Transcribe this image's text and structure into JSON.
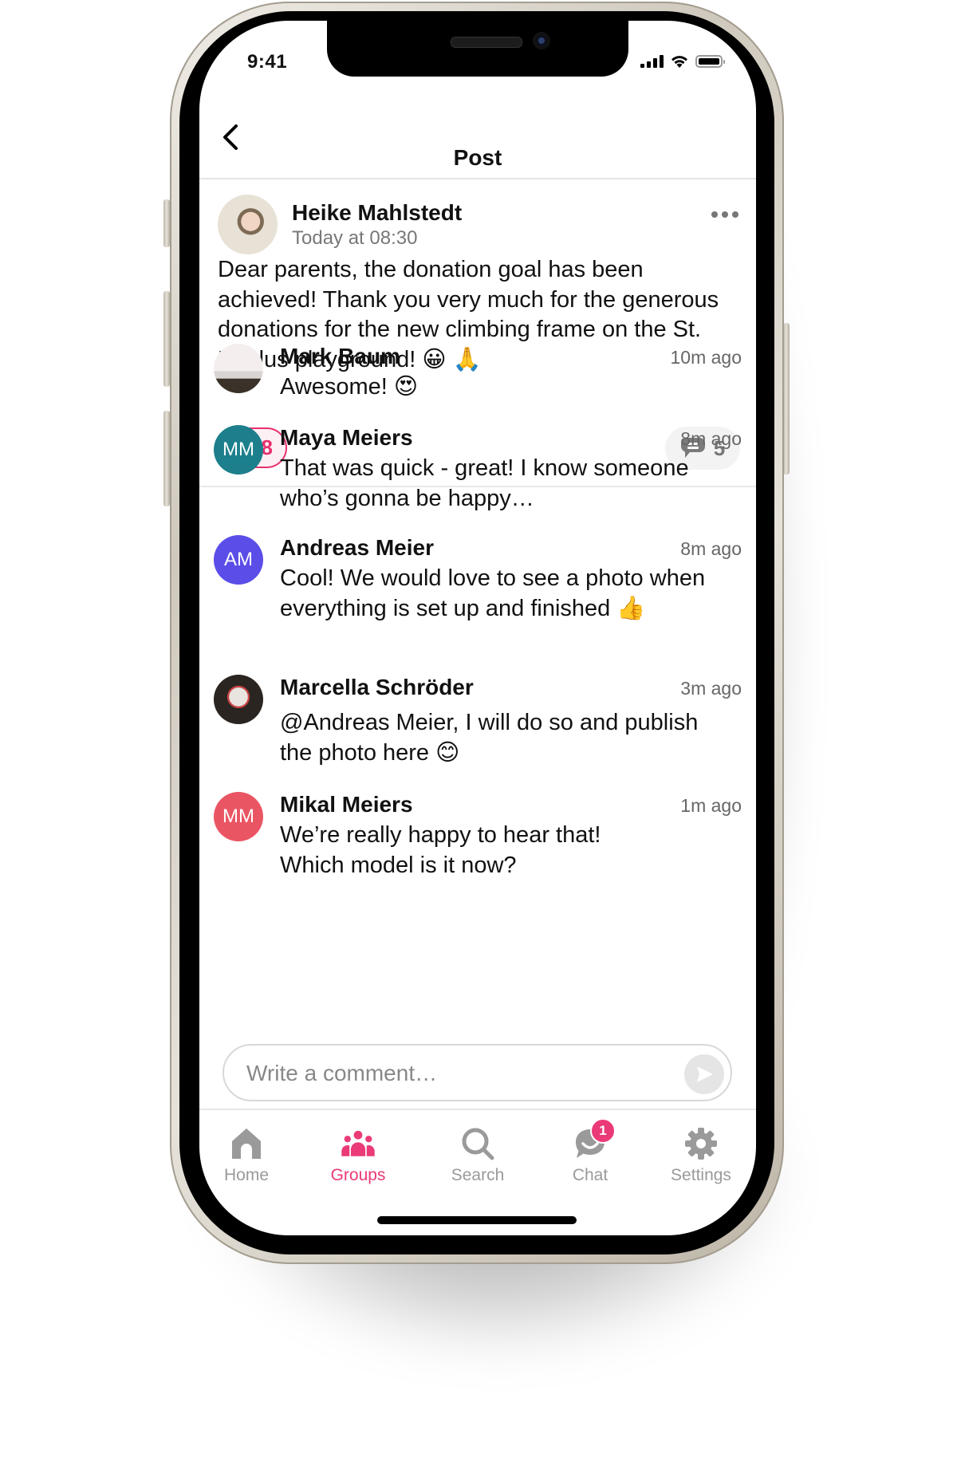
{
  "status_bar": {
    "time": "9:41"
  },
  "header": {
    "title": "Post",
    "back_icon": "chevron-left-icon"
  },
  "post": {
    "author": "Heike Mahlstedt",
    "timestamp": "Today at 08:30",
    "more_icon": "more-horizontal-icon",
    "text": "Dear parents, the donation goal has been achieved! Thank you very much for the generous donations for the new climbing frame on the St. Paulus playground! 😀 🙏",
    "reaction": {
      "emoji": "🙏",
      "count": "8"
    },
    "comment_count": "5"
  },
  "comments": [
    {
      "name": "Mark Baum",
      "time": "10m ago",
      "text": "Awesome! 😍",
      "avatar": {
        "type": "photo"
      }
    },
    {
      "name": "Maya Meiers",
      "time": "8m ago",
      "text": "That was quick - great! I know someone who’s gonna be happy…",
      "avatar": {
        "type": "initials",
        "initials": "MM",
        "color": "#1d7f8c"
      }
    },
    {
      "name": "Andreas Meier",
      "time": "8m ago",
      "text": "Cool! We would love to see a photo when everything is set up and finished 👍",
      "avatar": {
        "type": "initials",
        "initials": "AM",
        "color": "#5b4de8"
      }
    },
    {
      "name": "Marcella Schröder",
      "time": "3m ago",
      "text": "@Andreas Meier, I will do so and publish the photo here 😊",
      "avatar": {
        "type": "photo"
      }
    },
    {
      "name": "Mikal Meiers",
      "time": "1m ago",
      "text": "We’re really happy to hear that! Which model is it now?",
      "avatar": {
        "type": "initials",
        "initials": "MM",
        "color": "#ea5564"
      }
    }
  ],
  "comment_input": {
    "placeholder": "Write a comment…",
    "value": "",
    "send_icon": "send-icon"
  },
  "tabbar": {
    "items": [
      {
        "label": "Home",
        "icon": "home-icon",
        "active": false
      },
      {
        "label": "Groups",
        "icon": "groups-icon",
        "active": true
      },
      {
        "label": "Search",
        "icon": "search-icon",
        "active": false
      },
      {
        "label": "Chat",
        "icon": "chat-icon",
        "active": false,
        "badge": "1"
      },
      {
        "label": "Settings",
        "icon": "gear-icon",
        "active": false
      }
    ]
  },
  "colors": {
    "accent": "#ea3a78",
    "inactive": "#9a9a9a"
  }
}
